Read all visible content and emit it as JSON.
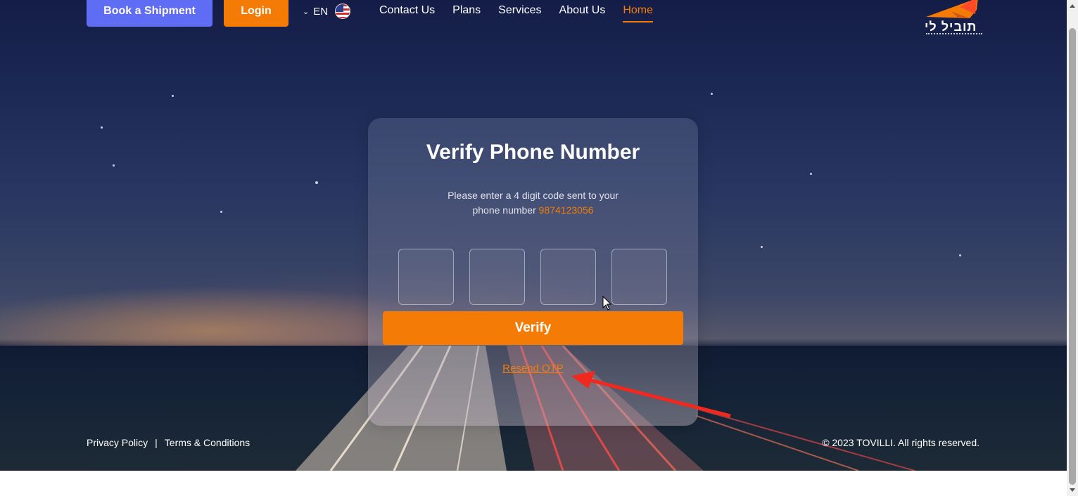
{
  "header": {
    "book_label": "Book a Shipment",
    "login_label": "Login",
    "language": "EN",
    "nav": [
      {
        "label": "Contact Us"
      },
      {
        "label": "Plans"
      },
      {
        "label": "Services"
      },
      {
        "label": "About Us"
      },
      {
        "label": "Home",
        "active": true
      }
    ],
    "logo_text": "תוביל לי"
  },
  "verify_card": {
    "title": "Verify Phone Number",
    "description": "Please enter a 4 digit code sent to your phone number",
    "phone": "9874123056",
    "otp_digits": [
      "",
      "",
      "",
      ""
    ],
    "verify_label": "Verify",
    "resend_label": "Resend OTP"
  },
  "footer": {
    "privacy": "Privacy Policy",
    "separator": "|",
    "terms": "Terms & Conditions",
    "copyright": "© 2023 TOVILLI. All rights reserved."
  },
  "colors": {
    "accent": "#f47c06",
    "primary_button": "#5f6df5",
    "annotation_arrow": "#f0281e"
  }
}
